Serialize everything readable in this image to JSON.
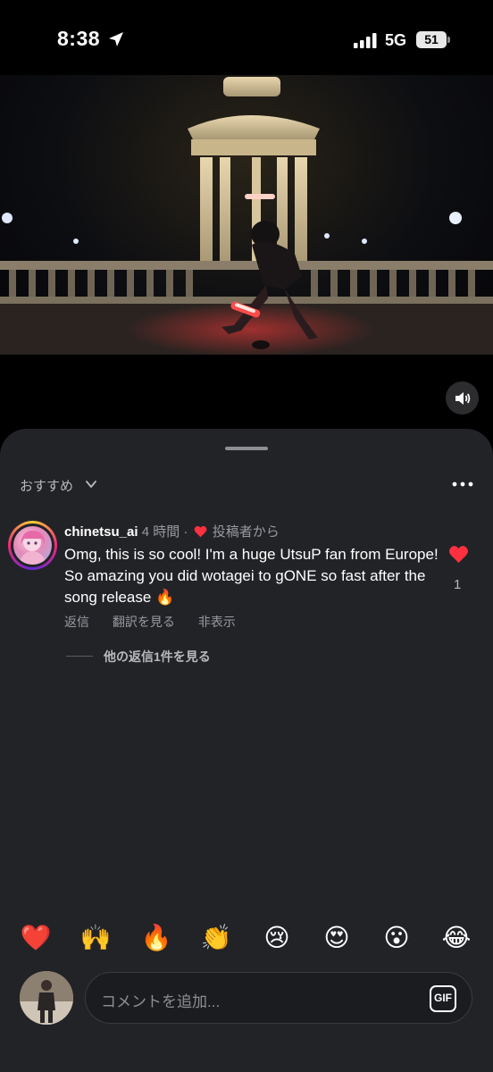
{
  "status_bar": {
    "time": "8:38",
    "network": "5G",
    "battery": "51"
  },
  "video": {
    "volume_icon": "speaker-icon"
  },
  "comments": {
    "sort_label": "おすすめ",
    "comment": {
      "username": "chinetsu_ai",
      "time_ago": "4 時間 ·",
      "author_badge": "投稿者から",
      "text": "Omg, this is so cool! I'm a huge UtsuP fan from Europe! So amazing you did wotagei to gONE so fast after the song release 🔥",
      "like_count": "1",
      "actions": {
        "reply": "返信",
        "translate": "翻訳を見る",
        "hide": "非表示"
      },
      "view_replies": "他の返信1件を見る"
    },
    "quick_emojis": [
      "❤️",
      "🙌",
      "🔥",
      "👏",
      "😢",
      "😍",
      "😮",
      "😂"
    ],
    "input": {
      "placeholder": "コメントを追加...",
      "gif_label": "GIF"
    }
  },
  "colors": {
    "sheet_bg": "#222327",
    "heart": "#ff3040",
    "muted_text": "#9a9aa0"
  }
}
